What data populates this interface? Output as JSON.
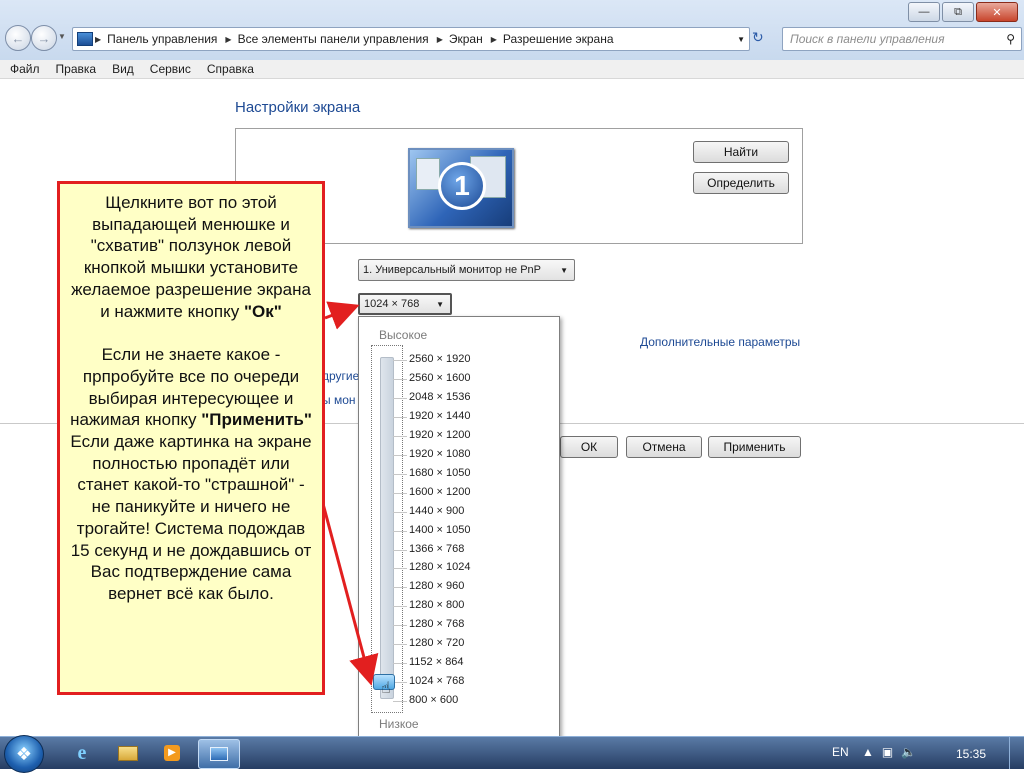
{
  "window": {
    "breadcrumbs": [
      "Панель управления",
      "Все элементы панели управления",
      "Экран",
      "Разрешение экрана"
    ],
    "search_placeholder": "Поиск в панели управления",
    "menu": [
      "Файл",
      "Правка",
      "Вид",
      "Сервис",
      "Справка"
    ]
  },
  "content": {
    "title": "Настройки экрана",
    "monitor_number": "1",
    "find_button": "Найти",
    "identify_button": "Определить",
    "display_select": "1. Универсальный монитор не PnP",
    "resolution_select": "1024 × 768",
    "advanced_link": "Дополнительные параметры",
    "partial_link_1": "другие",
    "partial_link_2": "ы мон",
    "ok_button": "ОК",
    "cancel_button": "Отмена",
    "apply_button": "Применить"
  },
  "resolution_popup": {
    "high_label": "Высокое",
    "low_label": "Низкое",
    "options": [
      "2560 × 1920",
      "2560 × 1600",
      "2048 × 1536",
      "1920 × 1440",
      "1920 × 1200",
      "1920 × 1080",
      "1680 × 1050",
      "1600 × 1200",
      "1440 × 900",
      "1400 × 1050",
      "1366 × 768",
      "1280 × 1024",
      "1280 × 960",
      "1280 × 800",
      "1280 × 768",
      "1280 × 720",
      "1152 × 864",
      "1024 × 768",
      "800 × 600"
    ],
    "selected": "1024 × 768"
  },
  "callout": {
    "para1_text": "Щелкните вот по этой выпадающей менюшке и \"схватив\" ползунок левой кнопкой мышки установите желаемое разрешение экрана и нажмите кнопку ",
    "para1_bold": "\"Ок\"",
    "para2_text": "Если не знаете какое - прпробуйте все по очереди выбирая интересующее и нажимая кнопку ",
    "para2_bold": "\"Применить\"",
    "para2_rest": " Если даже картинка на экране полностью пропадёт или станет какой-то \"страшной\" - не паникуйте и ничего не трогайте! Система подождав 15 секунд и не дождавшись от Вас подтверждение сама вернет всё как было."
  },
  "taskbar": {
    "lang": "EN",
    "time": "15:35"
  },
  "colors": {
    "callout_border": "#e21f1f",
    "callout_bg": "#ffffc6",
    "link": "#1e4a94"
  }
}
